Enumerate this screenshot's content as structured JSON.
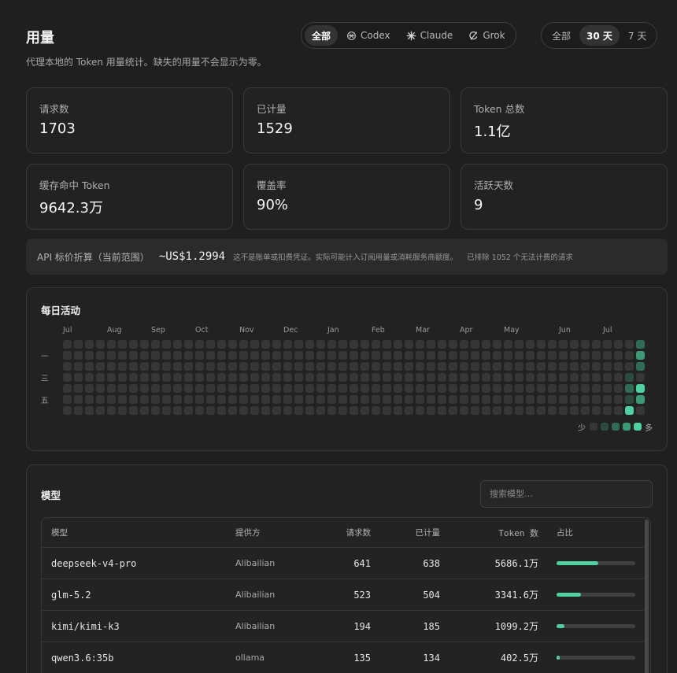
{
  "header": {
    "title": "用量",
    "subtitle": "代理本地的 Token 用量统计。缺失的用量不会显示为零。",
    "provider_filter": [
      {
        "label": "全部",
        "icon": "",
        "active": true
      },
      {
        "label": "Codex",
        "icon": "openai-icon",
        "active": false
      },
      {
        "label": "Claude",
        "icon": "claude-burst-icon",
        "active": false
      },
      {
        "label": "Grok",
        "icon": "grok-icon",
        "active": false
      }
    ],
    "range_filter": [
      {
        "label": "全部",
        "active": false
      },
      {
        "label": "30 天",
        "active": true
      },
      {
        "label": "7 天",
        "active": false
      }
    ]
  },
  "stats": [
    {
      "label": "请求数",
      "value": "1703"
    },
    {
      "label": "已计量",
      "value": "1529"
    },
    {
      "label": "Token 总数",
      "value": "1.1亿"
    },
    {
      "label": "缓存命中 Token",
      "value": "9642.3万"
    },
    {
      "label": "覆盖率",
      "value": "90%"
    },
    {
      "label": "活跃天数",
      "value": "9"
    }
  ],
  "api_estimate": {
    "label": "API 标价折算（当前范围）",
    "value": "~US$1.2994",
    "note": "这不是账单或扣费凭证。实际可能计入订阅用量或消耗服务商额度。",
    "excluded": "已排除 1052 个无法计费的请求"
  },
  "activity": {
    "title": "每日活动",
    "months": [
      "Jul",
      "Aug",
      "Sep",
      "Oct",
      "Nov",
      "Dec",
      "Jan",
      "Feb",
      "Mar",
      "Apr",
      "May",
      "Jun",
      "Jul"
    ],
    "weekday_labels": [
      "一",
      "三",
      "五"
    ],
    "legend_less": "少",
    "legend_more": "多",
    "level_colors": [
      "#363636",
      "#2e4a40",
      "#2f6b55",
      "#3a9a76",
      "#4fd1a0"
    ],
    "weeks": 53,
    "active_cells": [
      {
        "week": 51,
        "day": 3,
        "level": 1
      },
      {
        "week": 51,
        "day": 4,
        "level": 2
      },
      {
        "week": 51,
        "day": 5,
        "level": 1
      },
      {
        "week": 51,
        "day": 6,
        "level": 4
      },
      {
        "week": 52,
        "day": 0,
        "level": 2
      },
      {
        "week": 52,
        "day": 1,
        "level": 3
      },
      {
        "week": 52,
        "day": 2,
        "level": 2
      },
      {
        "week": 52,
        "day": 4,
        "level": 4
      },
      {
        "week": 52,
        "day": 5,
        "level": 3
      }
    ]
  },
  "models": {
    "title": "模型",
    "search_placeholder": "搜索模型…",
    "columns": {
      "model": "模型",
      "provider": "提供方",
      "requests": "请求数",
      "billed": "已计量",
      "tokens": "Token 数",
      "share": "占比"
    },
    "rows": [
      {
        "model": "deepseek-v4-pro",
        "provider": "Alibailian",
        "requests": "641",
        "billed": "638",
        "tokens": "5686.1万",
        "share": 0.53
      },
      {
        "model": "glm-5.2",
        "provider": "Alibailian",
        "requests": "523",
        "billed": "504",
        "tokens": "3341.6万",
        "share": 0.31
      },
      {
        "model": "kimi/kimi-k3",
        "provider": "Alibailian",
        "requests": "194",
        "billed": "185",
        "tokens": "1099.2万",
        "share": 0.1
      },
      {
        "model": "qwen3.6:35b",
        "provider": "ollama",
        "requests": "135",
        "billed": "134",
        "tokens": "402.5万",
        "share": 0.04
      }
    ]
  }
}
